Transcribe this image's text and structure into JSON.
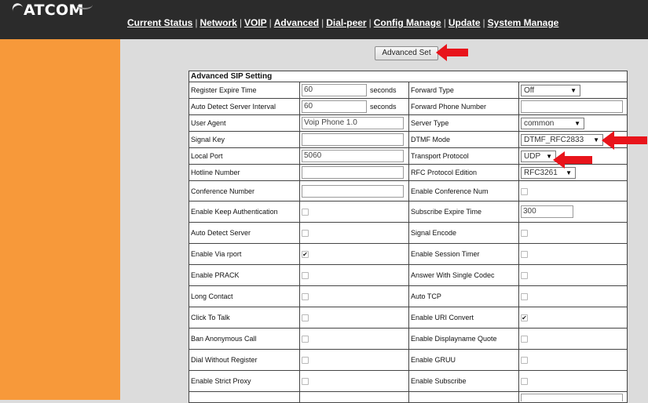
{
  "header": {
    "logo_text": "ATCOM",
    "nav": [
      "Current Status",
      "Network",
      "VOIP",
      "Advanced",
      "Dial-peer",
      "Config Manage",
      "Update",
      "System Manage"
    ]
  },
  "advanced_set_button": "Advanced Set",
  "section_title": "Advanced SIP Setting",
  "units": {
    "seconds": "seconds"
  },
  "left": [
    {
      "label": "Register Expire Time",
      "value": "60"
    },
    {
      "label": "Auto Detect Server Interval",
      "value": "60"
    },
    {
      "label": "User Agent",
      "value": "Voip Phone 1.0"
    },
    {
      "label": "Signal Key",
      "value": ""
    },
    {
      "label": "Local Port",
      "value": "5060"
    },
    {
      "label": "Hotline Number",
      "value": ""
    },
    {
      "label": "Conference Number",
      "value": ""
    },
    {
      "label": "Enable Keep Authentication",
      "checked": false
    },
    {
      "label": "Auto Detect Server",
      "checked": false
    },
    {
      "label": "Enable Via rport",
      "checked": true
    },
    {
      "label": "Enable PRACK",
      "checked": false
    },
    {
      "label": "Long Contact",
      "checked": false
    },
    {
      "label": "Click To Talk",
      "checked": false
    },
    {
      "label": "Ban Anonymous Call",
      "checked": false
    },
    {
      "label": "Dial Without Register",
      "checked": false
    },
    {
      "label": "Enable Strict Proxy",
      "checked": false
    }
  ],
  "right": [
    {
      "label": "Forward Type",
      "select": "Off"
    },
    {
      "label": "Forward Phone Number",
      "value": ""
    },
    {
      "label": "Server Type",
      "select": "common"
    },
    {
      "label": "DTMF Mode",
      "select": "DTMF_RFC2833"
    },
    {
      "label": "Transport Protocol",
      "select": "UDP"
    },
    {
      "label": "RFC Protocol Edition",
      "select": "RFC3261"
    },
    {
      "label": "Enable Conference Num",
      "checked": false
    },
    {
      "label": "Subscribe Expire Time",
      "value": "300"
    },
    {
      "label": "Signal Encode",
      "checked": false
    },
    {
      "label": "Enable Session Timer",
      "checked": false
    },
    {
      "label": "Answer With Single Codec",
      "checked": false
    },
    {
      "label": "Auto TCP",
      "checked": false
    },
    {
      "label": "Enable URI Convert",
      "checked": true
    },
    {
      "label": "Enable Displayname Quote",
      "checked": false
    },
    {
      "label": "Enable GRUU",
      "checked": false
    },
    {
      "label": "Enable Subscribe",
      "checked": false
    }
  ],
  "colors": {
    "topbar": "#2b2b2b",
    "sidebar": "#f7993a",
    "background": "#dcdcdc",
    "annotation_arrow": "#e8141b"
  }
}
